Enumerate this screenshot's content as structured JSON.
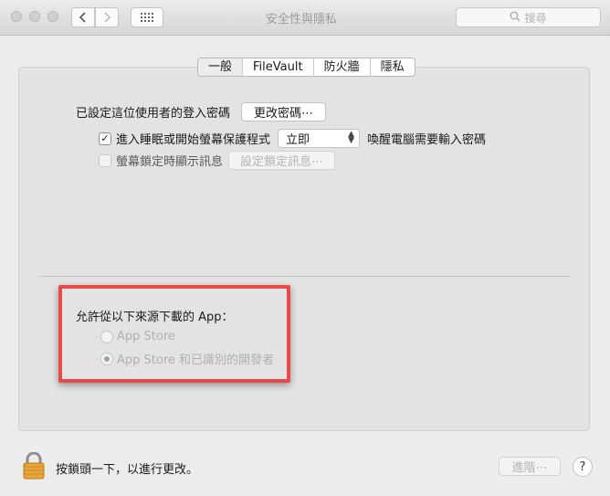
{
  "window": {
    "title": "安全性與隱私",
    "search_placeholder": "搜尋"
  },
  "toolbar": {
    "back_icon": "chevron-left-icon",
    "forward_icon": "chevron-right-icon",
    "grid_icon": "grid-icon",
    "search_icon": "magnifier-icon"
  },
  "tabs": [
    {
      "label": "一般",
      "active": true
    },
    {
      "label": "FileVault",
      "active": false
    },
    {
      "label": "防火牆",
      "active": false
    },
    {
      "label": "隱私",
      "active": false
    }
  ],
  "general": {
    "password_label": "已設定這位使用者的登入密碼",
    "change_password_button": "更改密碼⋯",
    "require_password_checkbox_label": "進入睡眠或開始螢幕保護程式",
    "require_password_checked": true,
    "require_password_delay": "立即",
    "require_password_suffix": "喚醒電腦需要輸入密碼",
    "show_message_checkbox_label": "螢幕鎖定時顯示訊息",
    "show_message_checked": false,
    "set_lock_message_button": "設定鎖定訊息⋯",
    "allow_apps_label": "允許從以下來源下載的 App：",
    "allow_options": [
      {
        "label": "App Store",
        "selected": false
      },
      {
        "label": "App Store 和已識別的開發者",
        "selected": true
      }
    ]
  },
  "footer": {
    "lock_text": "按鎖頭一下，以進行更改。",
    "advanced_button": "進階⋯",
    "help_button": "?"
  },
  "colors": {
    "highlight_border": "#e84a4a",
    "lock_body": "#e9a53a"
  }
}
